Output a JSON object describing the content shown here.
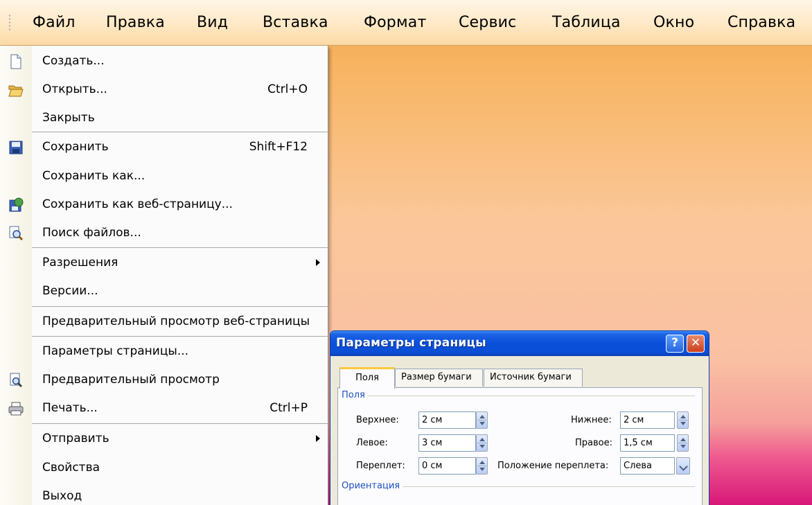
{
  "menubar": {
    "items": [
      {
        "label": "Файл"
      },
      {
        "label": "Правка"
      },
      {
        "label": "Вид"
      },
      {
        "label": "Вставка"
      },
      {
        "label": "Формат"
      },
      {
        "label": "Сервис"
      },
      {
        "label": "Таблица"
      },
      {
        "label": "Окно"
      },
      {
        "label": "Справка"
      }
    ]
  },
  "file_menu": {
    "items": [
      {
        "label": "Создать...",
        "icon": "new-document-icon"
      },
      {
        "label": "Открыть...",
        "shortcut": "Ctrl+O",
        "icon": "open-folder-icon"
      },
      {
        "label": "Закрыть"
      },
      {
        "label": "Сохранить",
        "shortcut": "Shift+F12",
        "icon": "save-disk-icon"
      },
      {
        "label": "Сохранить как..."
      },
      {
        "label": "Сохранить как веб-страницу...",
        "icon": "save-web-page-icon"
      },
      {
        "label": "Поиск файлов...",
        "icon": "file-search-icon"
      },
      {
        "label": "Разрешения",
        "submenu": true
      },
      {
        "label": "Версии..."
      },
      {
        "label": "Предварительный просмотр веб-страницы"
      },
      {
        "label": "Параметры страницы..."
      },
      {
        "label": "Предварительный просмотр",
        "icon": "print-preview-icon"
      },
      {
        "label": "Печать...",
        "shortcut": "Ctrl+P",
        "icon": "printer-icon"
      },
      {
        "label": "Отправить",
        "submenu": true
      },
      {
        "label": "Свойства"
      },
      {
        "label": "Выход"
      }
    ]
  },
  "dialog": {
    "title": "Параметры страницы",
    "help_button": "?",
    "close_button": "✕",
    "tabs": [
      {
        "label": "Поля",
        "active": true
      },
      {
        "label": "Размер бумаги"
      },
      {
        "label": "Источник бумаги"
      }
    ],
    "margins_group": "Поля",
    "fields": {
      "top": {
        "label": "Верхнее:",
        "value": "2 см"
      },
      "bottom": {
        "label": "Нижнее:",
        "value": "2 см"
      },
      "left": {
        "label": "Левое:",
        "value": "3 см"
      },
      "right": {
        "label": "Правое:",
        "value": "1,5 см"
      },
      "gutter": {
        "label": "Переплет:",
        "value": "0 см"
      },
      "gutter_pos": {
        "label": "Положение переплета:",
        "value": "Слева"
      }
    },
    "orientation_group": "Ориентация"
  },
  "colors": {
    "titlebar": "#0a4fd8",
    "menu_background": "#fbfbfb",
    "desktop_top": "#f4a94e",
    "desktop_bottom": "#d81779"
  }
}
